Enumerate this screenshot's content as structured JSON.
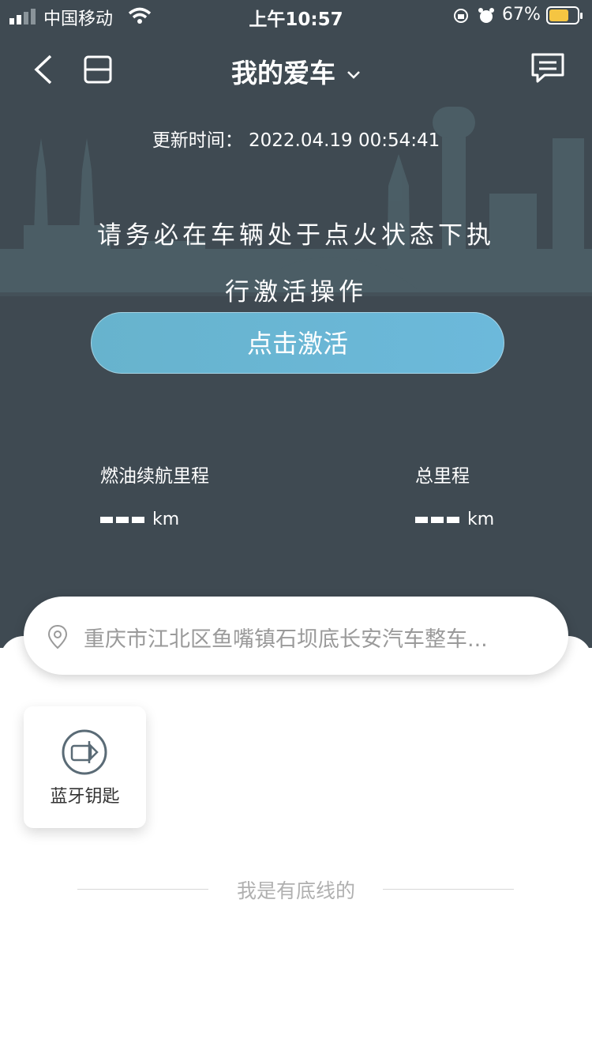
{
  "status_bar": {
    "carrier": "中国移动",
    "time": "上午10:57",
    "battery": "67%"
  },
  "header": {
    "title": "我的爱车",
    "back_icon": "chevron-left-icon",
    "layout_icon": "layout-icon",
    "message_icon": "message-icon"
  },
  "vehicle": {
    "update_label": "更新时间：",
    "update_time": "2022.04.19 00:54:41",
    "warning": "请务必在车辆处于点火状态下执行激活操作",
    "activate_button": "点击激活"
  },
  "stats": [
    {
      "label": "燃油续航里程",
      "value": "---",
      "unit": "km"
    },
    {
      "label": "总里程",
      "value": "---",
      "unit": "km"
    }
  ],
  "location": {
    "address": "重庆市江北区鱼嘴镇石坝底长安汽车整车..."
  },
  "functions": [
    {
      "label": "蓝牙钥匙",
      "icon": "bluetooth-key-icon"
    }
  ],
  "footer": {
    "text": "我是有底线的"
  },
  "colors": {
    "header_bg": "#3f4a52",
    "accent": "#6cb9db",
    "battery": "#f5c542"
  }
}
